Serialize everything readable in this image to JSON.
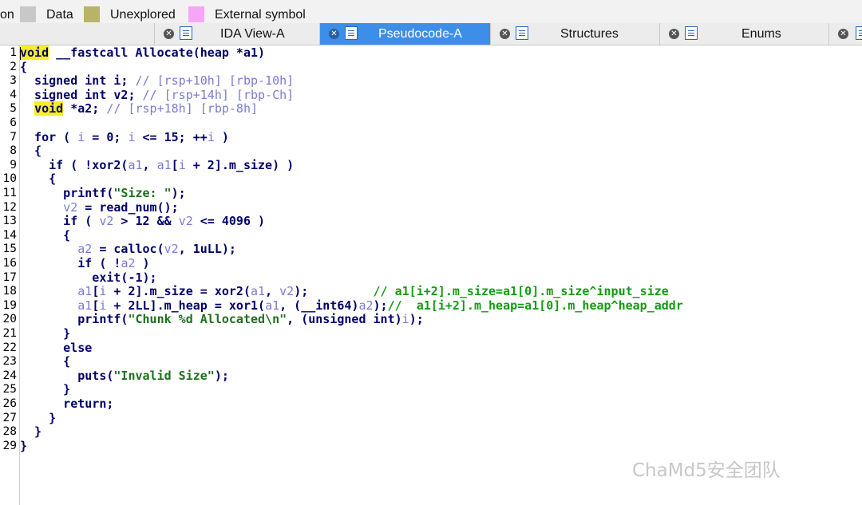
{
  "legend": {
    "items": [
      {
        "label": "on",
        "color": ""
      },
      {
        "label": "Data",
        "color": "#c8c8c8"
      },
      {
        "label": "Unexplored",
        "color": "#b7b46a"
      },
      {
        "label": "External symbol",
        "color": "#f7a6f7"
      }
    ]
  },
  "tabs": [
    {
      "label": "IDA View-A",
      "icon": "listing-icon",
      "active": false
    },
    {
      "label": "Pseudocode-A",
      "icon": "pseudocode-icon",
      "active": true
    },
    {
      "label": "Structures",
      "icon": "structures-icon",
      "active": false
    },
    {
      "label": "Enums",
      "icon": "enums-icon",
      "active": false
    }
  ],
  "code": {
    "line_numbers": [
      "1",
      "2",
      "3",
      "4",
      "5",
      "6",
      "7",
      "8",
      "9",
      "10",
      "11",
      "12",
      "13",
      "14",
      "15",
      "16",
      "17",
      "18",
      "19",
      "20",
      "21",
      "22",
      "23",
      "24",
      "25",
      "26",
      "27",
      "28",
      "29"
    ],
    "lines": [
      [
        {
          "t": "void",
          "c": "hl"
        },
        {
          "t": " __fastcall Allocate(heap *a1)",
          "c": "kw"
        }
      ],
      [
        {
          "t": "{",
          "c": "kw"
        }
      ],
      [
        {
          "t": "  signed int i; ",
          "c": "kw"
        },
        {
          "t": "// [rsp+10h] [rbp-10h]",
          "c": "cm"
        }
      ],
      [
        {
          "t": "  signed int v2; ",
          "c": "kw"
        },
        {
          "t": "// [rsp+14h] [rbp-Ch]",
          "c": "cm"
        }
      ],
      [
        {
          "t": "  ",
          "c": "kw"
        },
        {
          "t": "void",
          "c": "hl"
        },
        {
          "t": " *a2; ",
          "c": "kw"
        },
        {
          "t": "// [rsp+18h] [rbp-8h]",
          "c": "cm"
        }
      ],
      [],
      [
        {
          "t": "  for ( ",
          "c": "kw"
        },
        {
          "t": "i",
          "c": "vr"
        },
        {
          "t": " = 0; ",
          "c": "kw"
        },
        {
          "t": "i",
          "c": "vr"
        },
        {
          "t": " <= 15; ++",
          "c": "kw"
        },
        {
          "t": "i",
          "c": "vr"
        },
        {
          "t": " )",
          "c": "kw"
        }
      ],
      [
        {
          "t": "  {",
          "c": "kw"
        }
      ],
      [
        {
          "t": "    if ( !xor2(",
          "c": "kw"
        },
        {
          "t": "a1",
          "c": "vr"
        },
        {
          "t": ", ",
          "c": "kw"
        },
        {
          "t": "a1",
          "c": "vr"
        },
        {
          "t": "[",
          "c": "kw"
        },
        {
          "t": "i",
          "c": "vr"
        },
        {
          "t": " + 2].m_size) )",
          "c": "kw"
        }
      ],
      [
        {
          "t": "    {",
          "c": "kw"
        }
      ],
      [
        {
          "t": "      printf(",
          "c": "kw"
        },
        {
          "t": "\"Size: \"",
          "c": "st"
        },
        {
          "t": ");",
          "c": "kw"
        }
      ],
      [
        {
          "t": "      ",
          "c": "kw"
        },
        {
          "t": "v2",
          "c": "vr"
        },
        {
          "t": " = read_num();",
          "c": "kw"
        }
      ],
      [
        {
          "t": "      if ( ",
          "c": "kw"
        },
        {
          "t": "v2",
          "c": "vr"
        },
        {
          "t": " > 12 && ",
          "c": "kw"
        },
        {
          "t": "v2",
          "c": "vr"
        },
        {
          "t": " <= 4096 )",
          "c": "kw"
        }
      ],
      [
        {
          "t": "      {",
          "c": "kw"
        }
      ],
      [
        {
          "t": "        ",
          "c": "kw"
        },
        {
          "t": "a2",
          "c": "vr"
        },
        {
          "t": " = calloc(",
          "c": "kw"
        },
        {
          "t": "v2",
          "c": "vr"
        },
        {
          "t": ", 1uLL);",
          "c": "kw"
        }
      ],
      [
        {
          "t": "        if ( !",
          "c": "kw"
        },
        {
          "t": "a2",
          "c": "vr"
        },
        {
          "t": " )",
          "c": "kw"
        }
      ],
      [
        {
          "t": "          exit(-1);",
          "c": "kw"
        }
      ],
      [
        {
          "t": "        ",
          "c": "kw"
        },
        {
          "t": "a1",
          "c": "vr"
        },
        {
          "t": "[",
          "c": "kw"
        },
        {
          "t": "i",
          "c": "vr"
        },
        {
          "t": " + 2].m_size = xor2(",
          "c": "kw"
        },
        {
          "t": "a1",
          "c": "vr"
        },
        {
          "t": ", ",
          "c": "kw"
        },
        {
          "t": "v2",
          "c": "vr"
        },
        {
          "t": ");         ",
          "c": "kw"
        },
        {
          "t": "// a1[i+2].m_size=a1[0].m_size^input_size",
          "c": "cmg"
        }
      ],
      [
        {
          "t": "        ",
          "c": "kw"
        },
        {
          "t": "a1",
          "c": "vr"
        },
        {
          "t": "[",
          "c": "kw"
        },
        {
          "t": "i",
          "c": "vr"
        },
        {
          "t": " + 2LL].m_heap = xor1(",
          "c": "kw"
        },
        {
          "t": "a1",
          "c": "vr"
        },
        {
          "t": ", (__int64)",
          "c": "kw"
        },
        {
          "t": "a2",
          "c": "vr"
        },
        {
          "t": ");",
          "c": "kw"
        },
        {
          "t": "//  a1[i+2].m_heap=a1[0].m_heap^heap_addr",
          "c": "cmg"
        }
      ],
      [
        {
          "t": "        printf(",
          "c": "kw"
        },
        {
          "t": "\"Chunk %d Allocated\\n\"",
          "c": "st"
        },
        {
          "t": ", (unsigned int)",
          "c": "kw"
        },
        {
          "t": "i",
          "c": "vr"
        },
        {
          "t": ");",
          "c": "kw"
        }
      ],
      [
        {
          "t": "      }",
          "c": "kw"
        }
      ],
      [
        {
          "t": "      else",
          "c": "kw"
        }
      ],
      [
        {
          "t": "      {",
          "c": "kw"
        }
      ],
      [
        {
          "t": "        puts(",
          "c": "kw"
        },
        {
          "t": "\"Invalid Size\"",
          "c": "st"
        },
        {
          "t": ");",
          "c": "kw"
        }
      ],
      [
        {
          "t": "      }",
          "c": "kw"
        }
      ],
      [
        {
          "t": "      return;",
          "c": "kw"
        }
      ],
      [
        {
          "t": "    }",
          "c": "kw"
        }
      ],
      [
        {
          "t": "  }",
          "c": "kw"
        }
      ],
      [
        {
          "t": "}",
          "c": "kw"
        }
      ]
    ]
  },
  "watermark": "ChaMd5安全团队"
}
